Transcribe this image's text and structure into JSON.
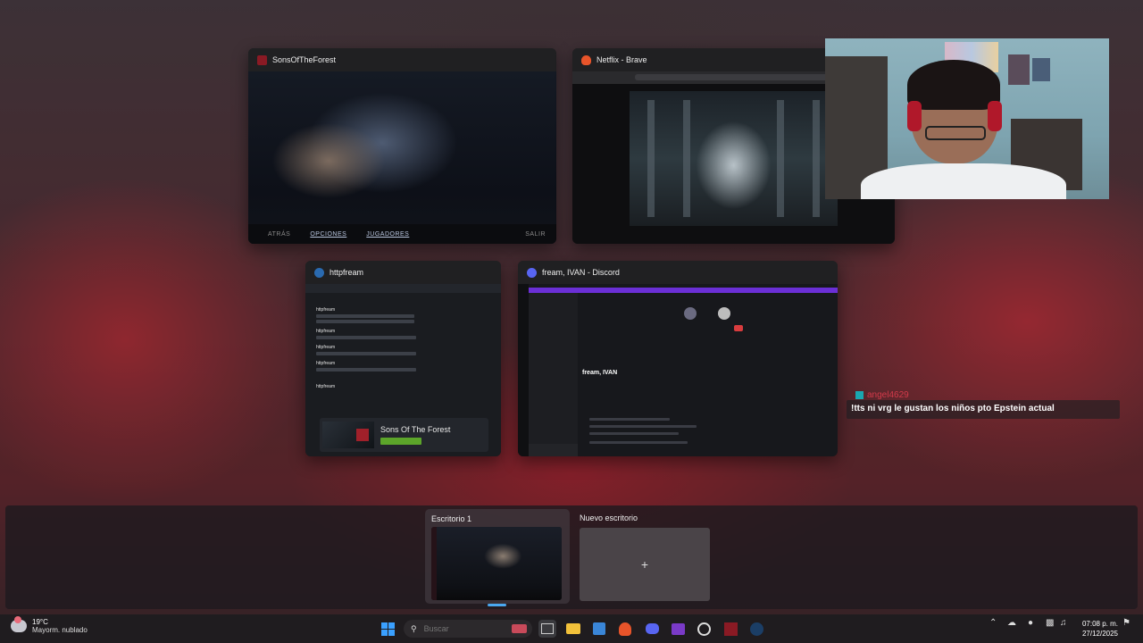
{
  "windows": {
    "sotf": {
      "title": "SonsOfTheForest",
      "menu": [
        "ATRÁS",
        "OPCIONES",
        "JUGADORES",
        "SALIR"
      ]
    },
    "netflix": {
      "title": "Netflix - Brave"
    },
    "steam": {
      "title": "httpfream",
      "sender": "httpfream",
      "game_card_title": "Sons Of The Forest"
    },
    "discord": {
      "title": "fream, IVAN - Discord",
      "dm_title": "fream, IVAN"
    }
  },
  "chat_overlay": {
    "username": "angel4629",
    "message": "!tts ni vrg le gustan los niños pto Epstein actual"
  },
  "desktops": {
    "current_label": "Escritorio 1",
    "new_label": "Nuevo escritorio",
    "new_symbol": "+"
  },
  "taskbar": {
    "weather_temp": "19°C",
    "weather_condition": "Mayorm. nublado",
    "search_placeholder": "Buscar",
    "time": "07:08 p. m.",
    "date": "27/12/2025"
  },
  "colors": {
    "accent": "#4aa8f0",
    "discord_purple": "#6b2fd6",
    "chat_username": "#d23a4a",
    "steam_green": "#5ca52a"
  }
}
